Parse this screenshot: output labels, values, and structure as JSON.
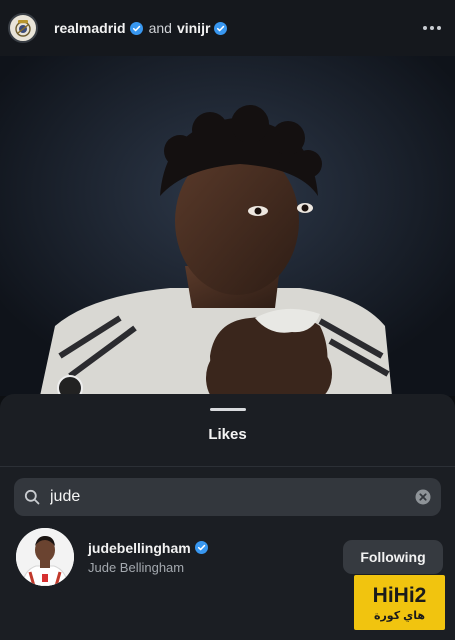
{
  "header": {
    "account_primary": "realmadrid",
    "conjunction": "and",
    "account_secondary": "vinijr",
    "verified_color": "#3897f0",
    "more_icon": "more-horizontal-icon"
  },
  "post": {
    "image": "photo-player-kissing-shirt"
  },
  "likes_sheet": {
    "title": "Likes",
    "search": {
      "value": "jude",
      "placeholder": "Search",
      "icon": "search-icon",
      "clear_icon": "clear-icon"
    },
    "results": [
      {
        "username": "judebellingham",
        "verified": true,
        "full_name": "Jude Bellingham",
        "button_label": "Following"
      }
    ]
  },
  "watermark": {
    "logo_text": "HiHi2",
    "logo_subtext": "هاي كورة"
  },
  "colors": {
    "background": "#0d0f12",
    "sheet": "#1b1e23",
    "search_field": "#33373d",
    "button": "#363a40",
    "watermark": "#f1c40f"
  }
}
